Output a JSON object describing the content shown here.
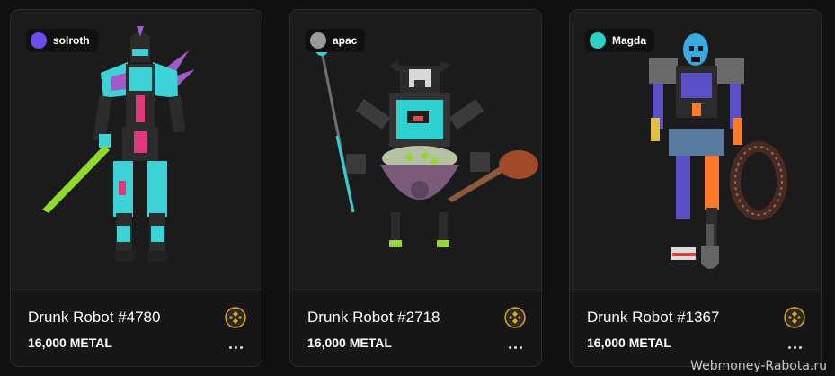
{
  "cards": [
    {
      "title": "Drunk Robot #4780",
      "price": "16,000 METAL",
      "owner": {
        "name": "solroth",
        "avatar_color": "#6b4cf0"
      },
      "chain_icon": "bnb-chain-icon",
      "more_icon": "more-dots-icon",
      "palette": {
        "primary": "#3dd3d6",
        "accent": "#e0387a",
        "secondary": "#a35ac9",
        "weapon": "#8edb2c"
      }
    },
    {
      "title": "Drunk Robot #2718",
      "price": "16,000 METAL",
      "owner": {
        "name": "apac",
        "avatar_color": "#9a9a9a"
      },
      "chain_icon": "bnb-chain-icon",
      "more_icon": "more-dots-icon",
      "palette": {
        "primary": "#3b3b3b",
        "accent": "#2fd1d0",
        "secondary": "#7b5a7a",
        "weapon": "#9ad23a"
      }
    },
    {
      "title": "Drunk Robot #1367",
      "price": "16,000 METAL",
      "owner": {
        "name": "Magda",
        "avatar_color": "#2fd0c4"
      },
      "chain_icon": "bnb-chain-icon",
      "more_icon": "more-dots-icon",
      "palette": {
        "primary": "#5b4fc8",
        "accent": "#ff7a2a",
        "secondary": "#3aa9e0",
        "weapon": "#666666"
      }
    }
  ],
  "watermark": "Webmoney-Rabota.ru",
  "colors": {
    "background": "#101010",
    "card": "#1b1b1b",
    "chain_gold": "#e2a91c"
  }
}
